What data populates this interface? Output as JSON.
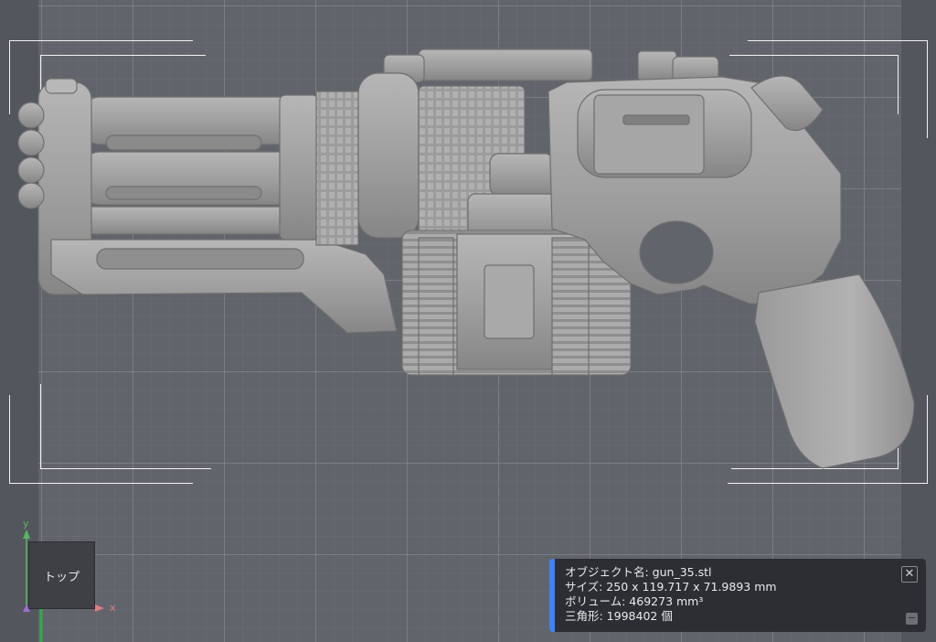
{
  "viewport": {
    "view_label": "トップ",
    "axis_x_label": "x",
    "axis_y_label": "y",
    "colors": {
      "axis_x": "#e07c84",
      "axis_y": "#5bb565",
      "axis_z": "#9b6fd4"
    }
  },
  "model": {
    "icon": "gun-3d-model",
    "color": "#a3a3a3"
  },
  "info_panel": {
    "object_name": "オブジェクト名: gun_35.stl",
    "size": "サイズ: 250 x 119.717 x 71.9893 mm",
    "volume": "ボリューム: 469273 mm³",
    "triangles": "三角形: 1998402 個",
    "close_icon": "close-icon",
    "minimize_icon": "minimize-icon",
    "accent_color": "#3d82f6"
  }
}
